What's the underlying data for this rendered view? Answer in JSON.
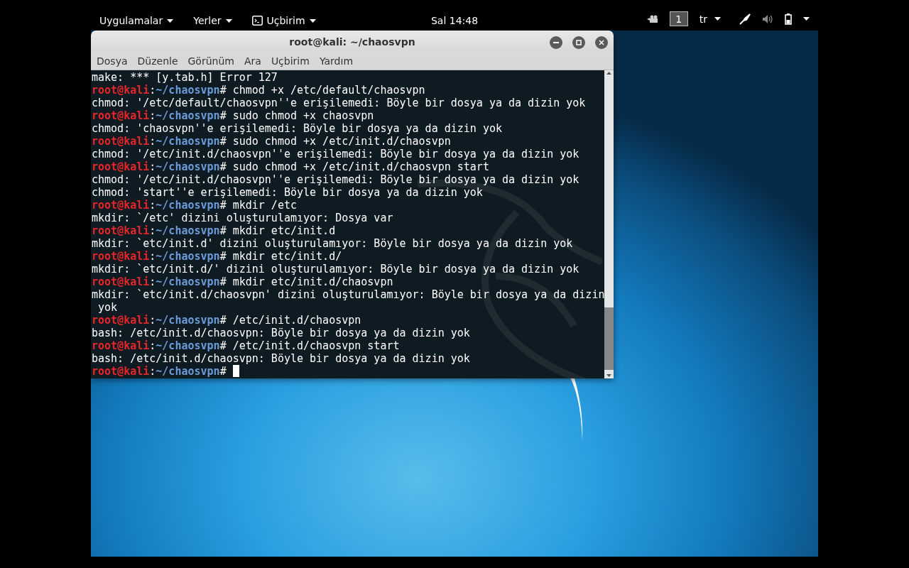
{
  "top_bar": {
    "menus": [
      {
        "label": "Uygulamalar",
        "kind": "menu"
      },
      {
        "label": "Yerler",
        "kind": "menu"
      },
      {
        "label": "Uçbirim",
        "kind": "app"
      }
    ],
    "clock": "Sal 14:48",
    "workspace": "1",
    "keyboard": "tr"
  },
  "window": {
    "title": "root@kali: ~/chaosvpn",
    "menu": [
      "Dosya",
      "Düzenle",
      "Görünüm",
      "Ara",
      "Uçbirim",
      "Yardım"
    ],
    "lines": [
      {
        "kind": "output",
        "text": "make: *** [y.tab.h] Error 127"
      },
      {
        "kind": "prompt",
        "user": "root@kali",
        "sep": ":",
        "path": "~/chaosvpn",
        "symbol": "#",
        "command": "chmod +x /etc/default/chaosvpn"
      },
      {
        "kind": "output",
        "text": "chmod: '/etc/default/chaosvpn''e erişilemedi: Böyle bir dosya ya da dizin yok"
      },
      {
        "kind": "prompt",
        "user": "root@kali",
        "sep": ":",
        "path": "~/chaosvpn",
        "symbol": "#",
        "command": "sudo chmod +x chaosvpn"
      },
      {
        "kind": "output",
        "text": "chmod: 'chaosvpn''e erişilemedi: Böyle bir dosya ya da dizin yok"
      },
      {
        "kind": "prompt",
        "user": "root@kali",
        "sep": ":",
        "path": "~/chaosvpn",
        "symbol": "#",
        "command": "sudo chmod +x /etc/init.d/chaosvpn"
      },
      {
        "kind": "output",
        "text": "chmod: '/etc/init.d/chaosvpn''e erişilemedi: Böyle bir dosya ya da dizin yok"
      },
      {
        "kind": "prompt",
        "user": "root@kali",
        "sep": ":",
        "path": "~/chaosvpn",
        "symbol": "#",
        "command": "sudo chmod +x /etc/init.d/chaosvpn start"
      },
      {
        "kind": "output",
        "text": "chmod: '/etc/init.d/chaosvpn''e erişilemedi: Böyle bir dosya ya da dizin yok"
      },
      {
        "kind": "output",
        "text": "chmod: 'start''e erişilemedi: Böyle bir dosya ya da dizin yok"
      },
      {
        "kind": "prompt",
        "user": "root@kali",
        "sep": ":",
        "path": "~/chaosvpn",
        "symbol": "#",
        "command": "mkdir /etc"
      },
      {
        "kind": "output",
        "text": "mkdir: `/etc' dizini oluşturulamıyor: Dosya var"
      },
      {
        "kind": "prompt",
        "user": "root@kali",
        "sep": ":",
        "path": "~/chaosvpn",
        "symbol": "#",
        "command": "mkdir etc/init.d"
      },
      {
        "kind": "output",
        "text": "mkdir: `etc/init.d' dizini oluşturulamıyor: Böyle bir dosya ya da dizin yok"
      },
      {
        "kind": "prompt",
        "user": "root@kali",
        "sep": ":",
        "path": "~/chaosvpn",
        "symbol": "#",
        "command": "mkdir etc/init.d/"
      },
      {
        "kind": "output",
        "text": "mkdir: `etc/init.d/' dizini oluşturulamıyor: Böyle bir dosya ya da dizin yok"
      },
      {
        "kind": "prompt",
        "user": "root@kali",
        "sep": ":",
        "path": "~/chaosvpn",
        "symbol": "#",
        "command": "mkdir etc/init.d/chaosvpn"
      },
      {
        "kind": "output",
        "text": "mkdir: `etc/init.d/chaosvpn' dizini oluşturulamıyor: Böyle bir dosya ya da dizin"
      },
      {
        "kind": "output",
        "text": " yok"
      },
      {
        "kind": "prompt",
        "user": "root@kali",
        "sep": ":",
        "path": "~/chaosvpn",
        "symbol": "#",
        "command": "/etc/init.d/chaosvpn"
      },
      {
        "kind": "output",
        "text": "bash: /etc/init.d/chaosvpn: Böyle bir dosya ya da dizin yok"
      },
      {
        "kind": "prompt",
        "user": "root@kali",
        "sep": ":",
        "path": "~/chaosvpn",
        "symbol": "#",
        "command": "/etc/init.d/chaosvpn start"
      },
      {
        "kind": "output",
        "text": "bash: /etc/init.d/chaosvpn: Böyle bir dosya ya da dizin yok"
      },
      {
        "kind": "prompt",
        "user": "root@kali",
        "sep": ":",
        "path": "~/chaosvpn",
        "symbol": "#",
        "cursor": true
      }
    ]
  }
}
